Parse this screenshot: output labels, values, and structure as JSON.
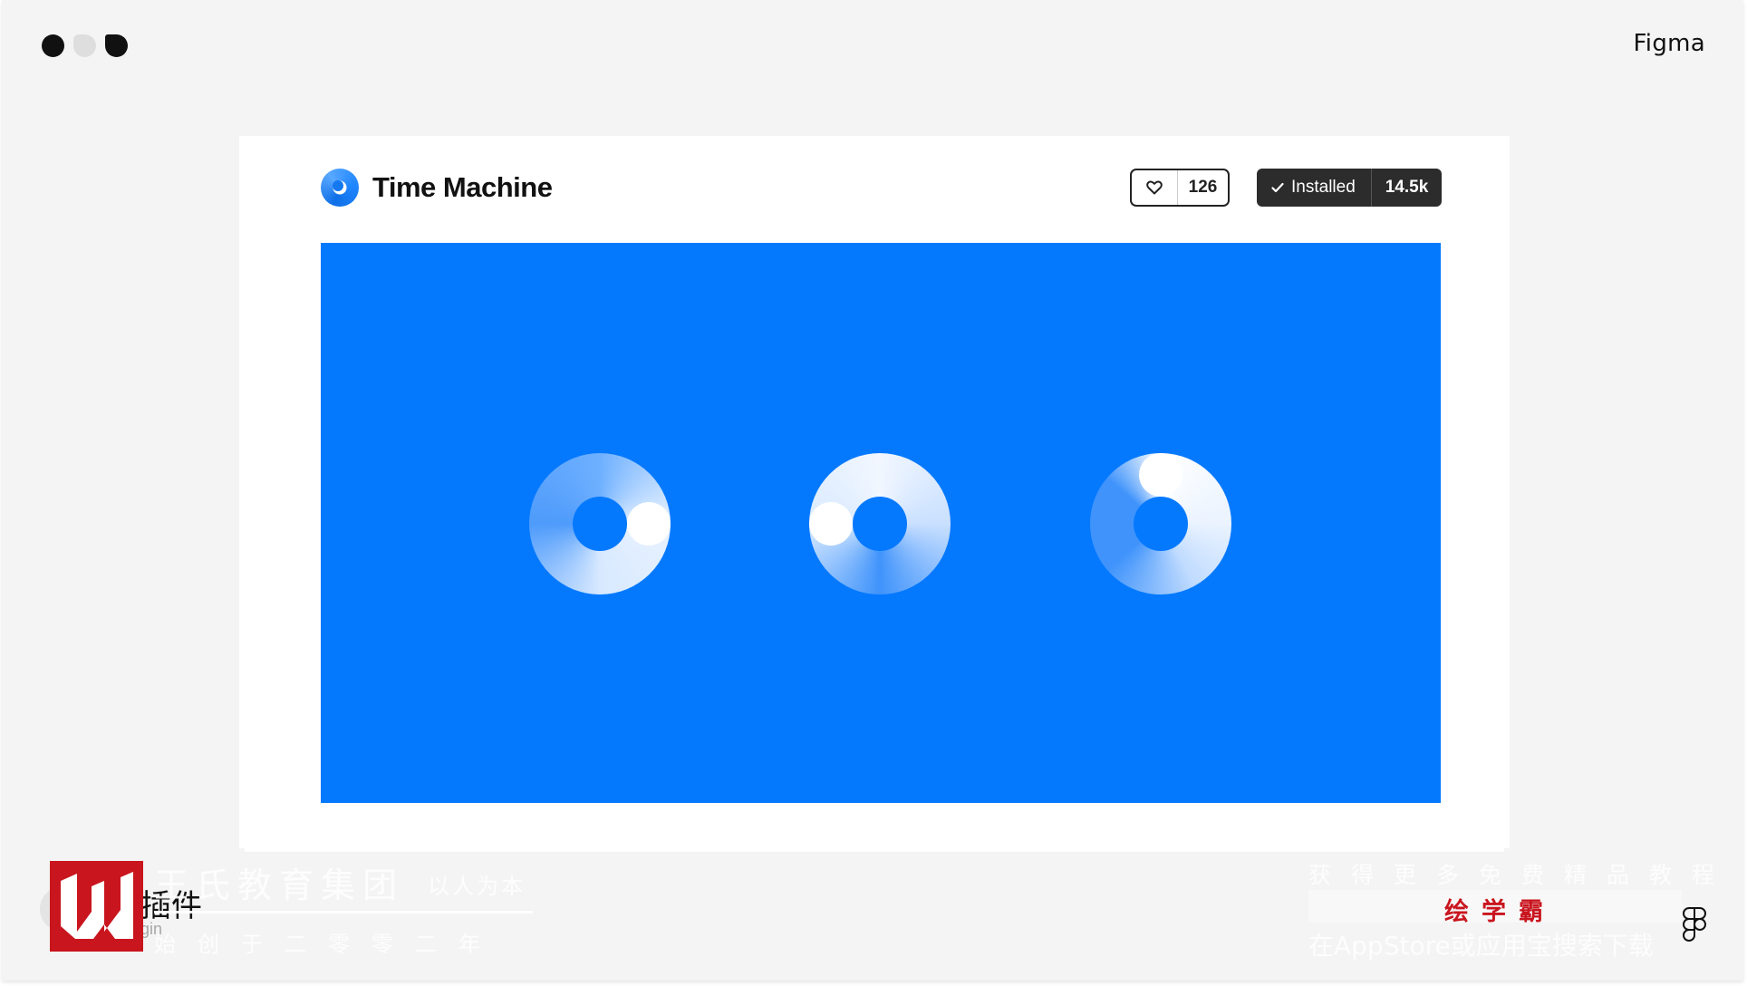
{
  "window": {
    "brand": "Figma"
  },
  "plugin": {
    "title": "Time Machine",
    "likes": "126",
    "install_label": "Installed",
    "install_count": "14.5k"
  },
  "colors": {
    "hero_blue": "#0579fe",
    "install_dark": "#2c2c2c",
    "watermark_red": "#c9151e"
  },
  "icons": {
    "heart": "heart-icon",
    "check": "check-icon",
    "plugin_logo": "time-machine-logo-icon"
  },
  "footer": {
    "plugin_snippet": "插件",
    "plugin_sub": "gin",
    "watermark_top": "王氏教育集团",
    "watermark_top_small": "以人为本",
    "watermark_bottom": "始创于二零零二年",
    "watermark_right_1": "获得更多免费精品教程",
    "watermark_right_2": "绘学霸",
    "watermark_right_3": "在AppStore或应用宝搜索下载"
  }
}
